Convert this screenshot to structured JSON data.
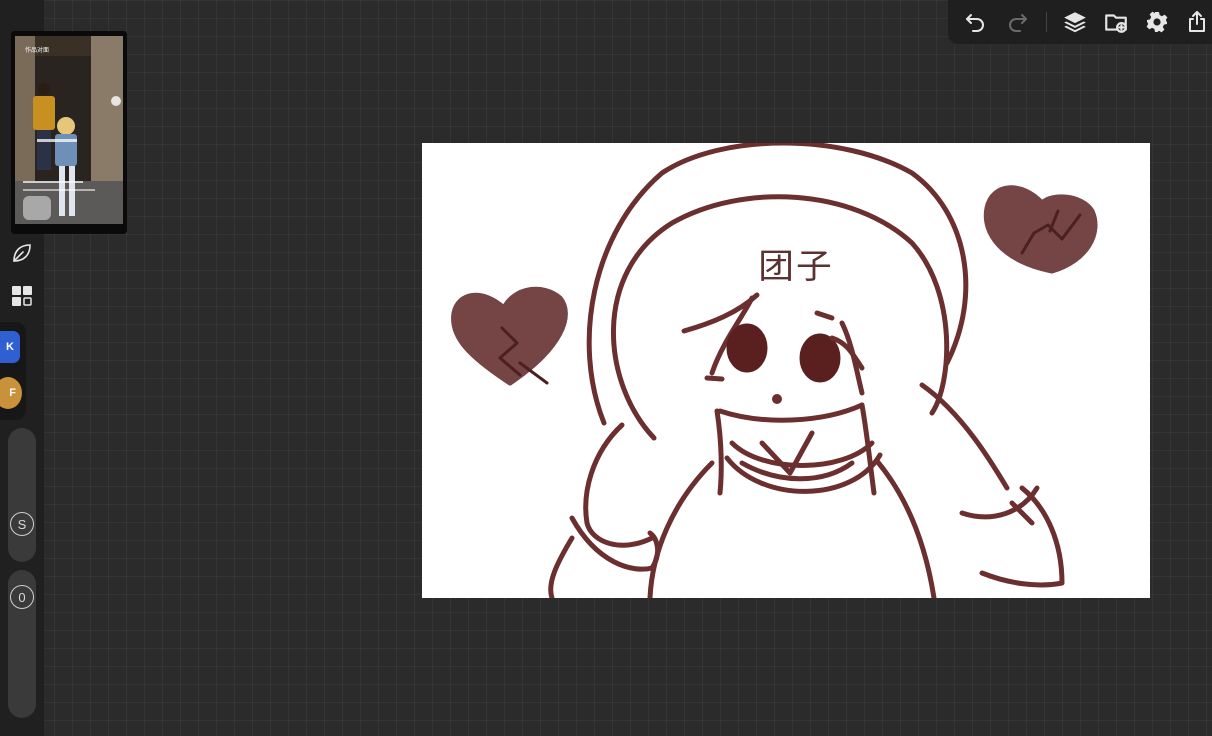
{
  "app": "drawing-app",
  "colors": {
    "background": "#2b2b2b",
    "panel": "#1f1f1f",
    "ink": "#6b2f2f",
    "heart": "#6e3a3a",
    "icon": "#e6e6e6",
    "disabled_icon": "#6a6a6a"
  },
  "toolbar": {
    "undo_icon": "undo-icon",
    "redo_icon": "redo-icon",
    "redo_enabled": false,
    "layers_icon": "layers-icon",
    "import_icon": "folder-import-icon",
    "settings_icon": "gear-icon",
    "share_icon": "share-icon"
  },
  "sidebar": {
    "reference_thumbnail_caption": "作品对面",
    "tools": [
      {
        "name": "leaf-icon"
      },
      {
        "name": "grid-icon"
      }
    ],
    "dock_apps": [
      {
        "label": "K",
        "color": "#2f5fd0"
      },
      {
        "label": "F",
        "color": "#c9913a"
      }
    ],
    "size_slider_label": "S",
    "opacity_slider_label": "0"
  },
  "canvas": {
    "text": "团子"
  }
}
